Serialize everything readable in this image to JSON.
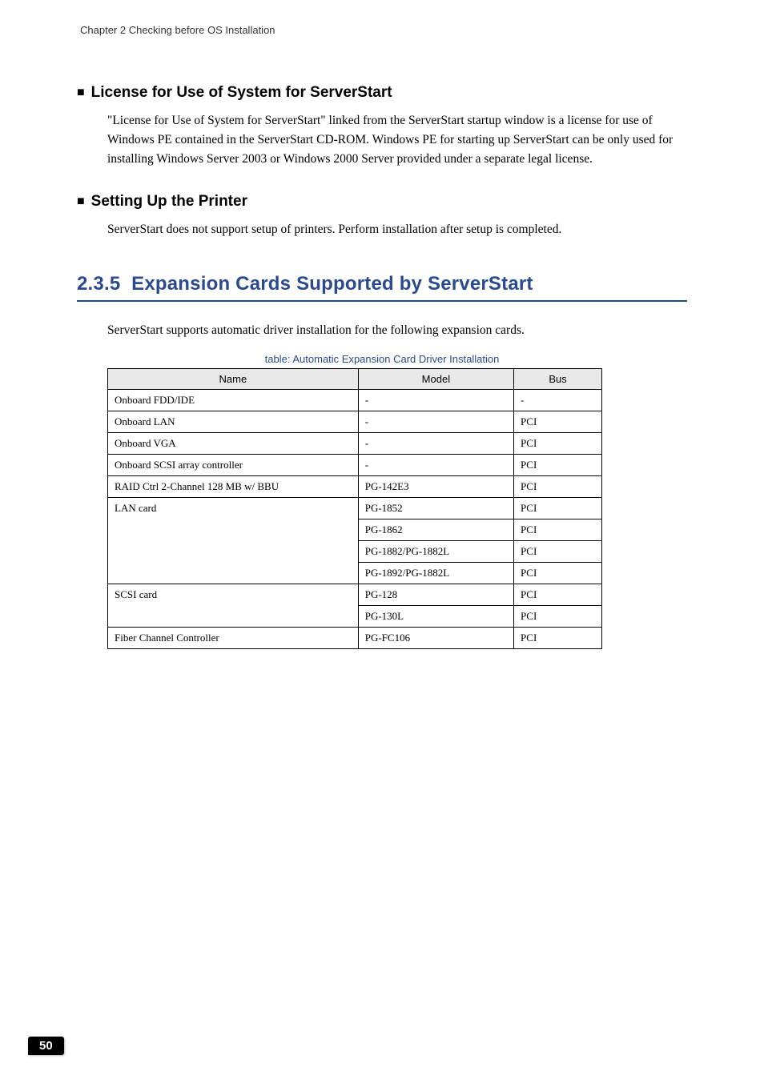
{
  "chapter_header": "Chapter 2  Checking before OS Installation",
  "sections": {
    "license": {
      "title": "License for Use of System for ServerStart",
      "body": "\"License for Use of System for ServerStart\" linked from the ServerStart startup window is a license for use of Windows PE contained in the ServerStart CD-ROM. Windows PE for starting up ServerStart can be only used for installing Windows Server 2003 or Windows 2000 Server provided under a separate legal license."
    },
    "printer": {
      "title": "Setting Up the Printer",
      "body": "ServerStart does not support setup of printers. Perform installation after setup is completed."
    },
    "expansion": {
      "number": "2.3.5",
      "title": "Expansion Cards Supported by ServerStart",
      "intro": "ServerStart supports automatic driver installation for the following expansion cards.",
      "table_caption": "table: Automatic Expansion Card Driver Installation",
      "table_headers": {
        "name": "Name",
        "model": "Model",
        "bus": "Bus"
      },
      "table_rows": [
        {
          "name": "Onboard FDD/IDE",
          "model": "-",
          "bus": "-",
          "name_rowspan": 1
        },
        {
          "name": "Onboard LAN",
          "model": "-",
          "bus": "PCI",
          "name_rowspan": 1
        },
        {
          "name": "Onboard VGA",
          "model": "-",
          "bus": "PCI",
          "name_rowspan": 1
        },
        {
          "name": "Onboard SCSI array controller",
          "model": "-",
          "bus": "PCI",
          "name_rowspan": 1
        },
        {
          "name": "RAID Ctrl 2-Channel 128 MB w/ BBU",
          "model": "PG-142E3",
          "bus": "PCI",
          "name_rowspan": 1
        },
        {
          "name": "LAN card",
          "model": "PG-1852",
          "bus": "PCI",
          "name_rowspan": 4
        },
        {
          "name": "",
          "model": "PG-1862",
          "bus": "PCI",
          "name_rowspan": 0
        },
        {
          "name": "",
          "model": "PG-1882/PG-1882L",
          "bus": "PCI",
          "name_rowspan": 0
        },
        {
          "name": "",
          "model": "PG-1892/PG-1882L",
          "bus": "PCI",
          "name_rowspan": 0
        },
        {
          "name": "SCSI card",
          "model": "PG-128",
          "bus": "PCI",
          "name_rowspan": 2
        },
        {
          "name": "",
          "model": "PG-130L",
          "bus": "PCI",
          "name_rowspan": 0
        },
        {
          "name": "Fiber Channel Controller",
          "model": "PG-FC106",
          "bus": "PCI",
          "name_rowspan": 1
        }
      ]
    }
  },
  "page_number": "50"
}
